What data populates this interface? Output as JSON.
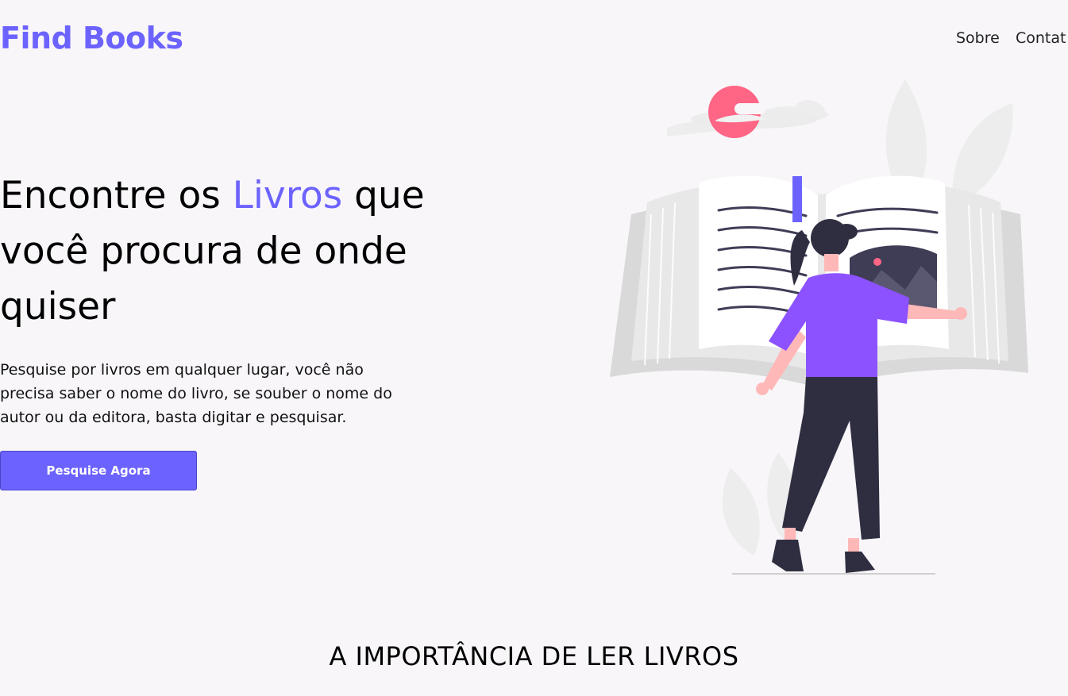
{
  "header": {
    "logo": "Find Books",
    "nav": [
      {
        "label": "Sobre"
      },
      {
        "label": "Contat"
      }
    ]
  },
  "hero": {
    "title_before": "Encontre os ",
    "title_accent": "Livros",
    "title_after": " que você procura de onde quiser",
    "description": "Pesquise por livros em qualquer lugar, você não precisa saber o nome do livro, se souber o nome do autor ou da editora, basta digitar e pesquisar.",
    "cta_label": "Pesquise Agora"
  },
  "section": {
    "title": "A IMPORTÂNCIA DE LER LIVROS"
  },
  "colors": {
    "accent": "#6c63ff",
    "background": "#f8f6f9",
    "sun": "#ff6584",
    "dark": "#2f2e41"
  },
  "illustration": {
    "icon": "woman-reading-book-illustration"
  }
}
